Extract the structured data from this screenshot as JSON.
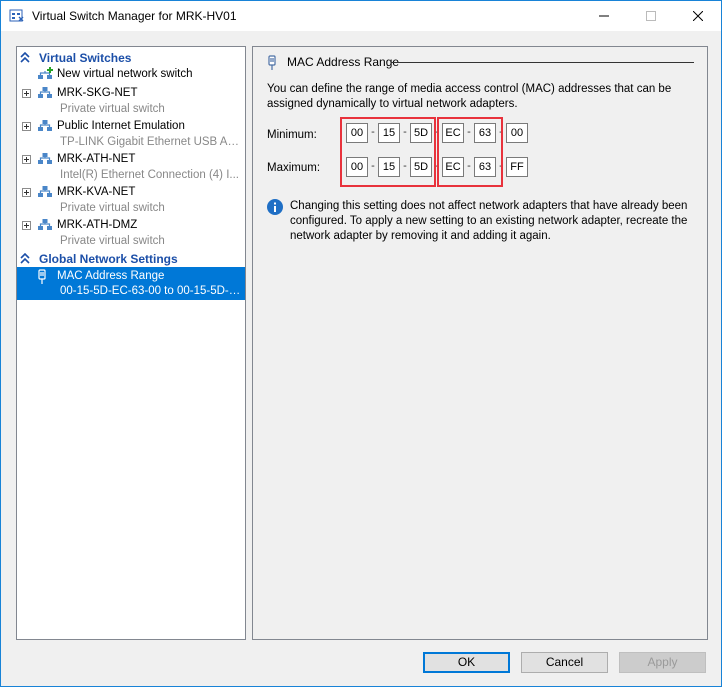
{
  "window": {
    "title": "Virtual Switch Manager for MRK-HV01"
  },
  "sections": {
    "virtual_switches": "Virtual Switches",
    "global_settings": "Global Network Settings"
  },
  "items": [
    {
      "title": "New virtual network switch",
      "subtitle": ""
    },
    {
      "title": "MRK-SKG-NET",
      "subtitle": "Private virtual switch"
    },
    {
      "title": "Public Internet Emulation",
      "subtitle": "TP-LINK Gigabit Ethernet USB Ada..."
    },
    {
      "title": "MRK-ATH-NET",
      "subtitle": "Intel(R) Ethernet Connection (4) I..."
    },
    {
      "title": "MRK-KVA-NET",
      "subtitle": "Private virtual switch"
    },
    {
      "title": "MRK-ATH-DMZ",
      "subtitle": "Private virtual switch"
    }
  ],
  "global_item": {
    "title": "MAC Address Range",
    "subtitle": "00-15-5D-EC-63-00 to 00-15-5D-E..."
  },
  "panel": {
    "title": "MAC Address Range",
    "description": "You can define the range of media access control (MAC) addresses that can be assigned dynamically to virtual network adapters.",
    "minimum_label": "Minimum:",
    "maximum_label": "Maximum:",
    "minimum": [
      "00",
      "15",
      "5D",
      "EC",
      "63",
      "00"
    ],
    "maximum": [
      "00",
      "15",
      "5D",
      "EC",
      "63",
      "FF"
    ],
    "info": "Changing this setting does not affect network adapters that have already been configured.  To apply a new setting to an existing network adapter, recreate the network adapter by removing it and adding it again."
  },
  "buttons": {
    "ok": "OK",
    "cancel": "Cancel",
    "apply": "Apply"
  },
  "colors": {
    "selection": "#0078d7",
    "section_header": "#1c4fa8",
    "highlight_box": "#e8323c"
  }
}
